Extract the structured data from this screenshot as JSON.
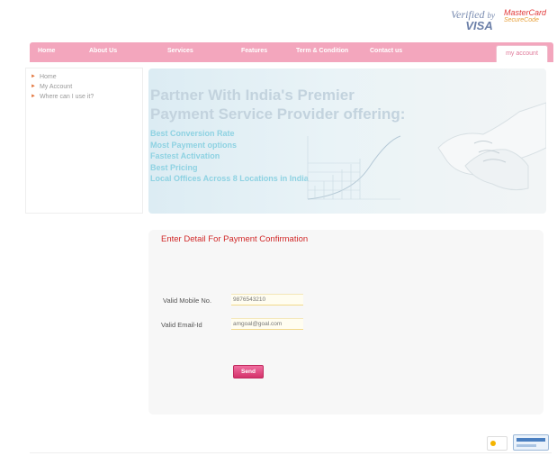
{
  "logos": {
    "visa_line1": "Verified",
    "visa_by": "by",
    "visa_line2": "VISA",
    "mc_line1": "MasterCard",
    "mc_line2": "SecureCode"
  },
  "nav": {
    "items": [
      {
        "label": "Home"
      },
      {
        "label": "About Us"
      },
      {
        "label": "Services"
      },
      {
        "label": "Features"
      },
      {
        "label": "Term & Condition"
      },
      {
        "label": "Contact us"
      }
    ],
    "account_tab": "my account"
  },
  "sidebar": {
    "items": [
      {
        "label": "Home"
      },
      {
        "label": "My Account"
      },
      {
        "label": "Where can I use it?"
      }
    ]
  },
  "banner": {
    "heading_line1": "Partner With India's Premier",
    "heading_line2": "Payment Service Provider offering:",
    "bullets": [
      "Best Conversion Rate",
      "Most Payment options",
      "Fastest Activation",
      "Best Pricing",
      "Local Offices Across 8 Locations in India"
    ]
  },
  "form": {
    "title": "Enter Detail For Payment Confirmation",
    "mobile_label": "Valid Mobile No.",
    "mobile_value": "9876543210",
    "email_label": "Valid Email-Id",
    "email_value": "amgoal@goal.com",
    "send_label": "Send"
  },
  "colors": {
    "nav": "#f3a6bd",
    "title_red": "#d12a2a",
    "banner_text": "#8ed2e2",
    "button_pink": "#d4326b"
  }
}
